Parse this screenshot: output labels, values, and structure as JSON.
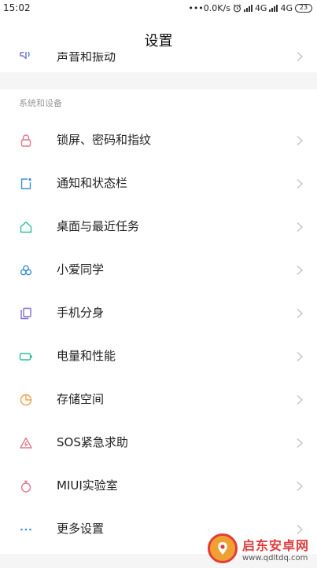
{
  "status_bar": {
    "time": "15:02",
    "net_speed": "•••0.0K/s",
    "alarm_icon": "alarm-icon",
    "network1": "4G",
    "network2": "4G",
    "battery": "23"
  },
  "header": {
    "title": "设置"
  },
  "partial_item": {
    "label": "声音和振动",
    "icon": "speaker-icon"
  },
  "section": {
    "title": "系统和设备",
    "items": [
      {
        "label": "锁屏、密码和指纹",
        "icon": "lock-icon",
        "color": "#e07a8a"
      },
      {
        "label": "通知和状态栏",
        "icon": "notification-icon",
        "color": "#3a8fd6"
      },
      {
        "label": "桌面与最近任务",
        "icon": "home-icon",
        "color": "#2fbf9a"
      },
      {
        "label": "小爱同学",
        "icon": "xiaoai-icon",
        "color": "#3a8fd6"
      },
      {
        "label": "手机分身",
        "icon": "dual-space-icon",
        "color": "#7a6fd6"
      },
      {
        "label": "电量和性能",
        "icon": "battery-icon",
        "color": "#2fbf9a"
      },
      {
        "label": "存储空间",
        "icon": "storage-icon",
        "color": "#f0a050"
      },
      {
        "label": "SOS紧急求助",
        "icon": "sos-icon",
        "color": "#e07a8a"
      },
      {
        "label": "MIUI实验室",
        "icon": "lab-icon",
        "color": "#e07a8a"
      },
      {
        "label": "更多设置",
        "icon": "more-icon",
        "color": "#3a8fd6"
      }
    ]
  },
  "watermark": {
    "title": "启东安卓网",
    "url": "www.qdltdq.com"
  }
}
